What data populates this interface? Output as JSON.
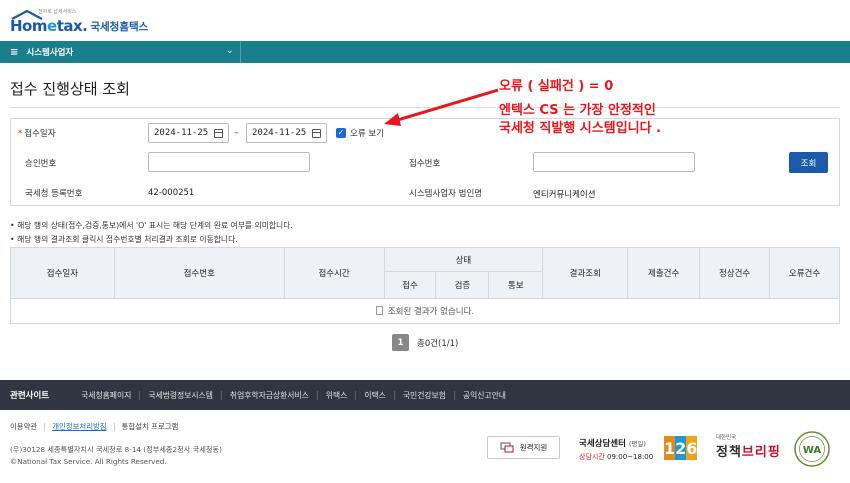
{
  "header": {
    "logo_tagline": "전자로 납세서비스",
    "logo_text_left": "Hom",
    "logo_text_e": "e",
    "logo_text_right": "tax.",
    "logo_kr": "국세청홈택스"
  },
  "nav": {
    "menu_label": "시스템사업자"
  },
  "page_title": "접수 진행상태 조회",
  "annotation": {
    "line1": "오류 ( 실패건 ) = 0",
    "line2": "엔텍스 CS 는 가장 안정적인",
    "line3": "국세청 직발행 시스템입니다 ."
  },
  "form": {
    "receipt_date_label": "접수일자",
    "date_from": "2024-11-25",
    "date_to": "2024-11-25",
    "date_sep": "–",
    "error_view_label": "오류 보기",
    "approval_no_label": "승인번호",
    "receipt_no_label": "접수번호",
    "search_button": "조회",
    "nts_reg_no_label": "국세청 등록번호",
    "nts_reg_no_value": "42-000251",
    "corp_name_label": "시스템사업자 법인명",
    "corp_name_value": "엔티커뮤니케이션"
  },
  "notes": {
    "note1": "• 해당 행의 상태(접수,검증,통보)에서 'O' 표시는 해당 단계의 완료 여부를 의미합니다.",
    "note2": "• 해당 행의 결과조회 클릭시 접수번호별 처리결과 조회로 이동합니다."
  },
  "table": {
    "headers": {
      "receipt_date": "접수일자",
      "receipt_no": "접수번호",
      "receipt_time": "접수시간",
      "status": "상태",
      "status_receipt": "접수",
      "status_verify": "검증",
      "status_notify": "통보",
      "result": "결과조회",
      "submitted": "제출건수",
      "normal": "정상건수",
      "error": "오류건수"
    },
    "empty_message": "조회된 결과가 없습니다."
  },
  "pager": {
    "current": "1",
    "total": "총0건(1/1)"
  },
  "footer": {
    "related_title": "관련사이트",
    "links": [
      "국세청홈페이지",
      "국세법령정보시스템",
      "취업후학자금상환서비스",
      "위택스",
      "이택스",
      "국민건강보험",
      "공익신고안내"
    ],
    "bottom_links": [
      "이용약관",
      "개인정보처리방침",
      "통합설치 프로그램"
    ],
    "address": "(우)30128 세종특별자치시 국세청로 8-14 (정부세종2청사 국세청동)",
    "copyright": "©National Tax Service. All Rights Reserved.",
    "remote_support": "원격지원",
    "center_title": "국세상담센터",
    "center_sub": "(평일)",
    "center_hours_label": "상담시간",
    "center_hours": "09:00~18:00",
    "center_number": [
      "1",
      "2",
      "6"
    ],
    "briefing_small": "대한민국",
    "briefing_big_1": "정책",
    "briefing_big_2": "브리핑",
    "wa_label": "WA"
  },
  "colors": {
    "nav": "#1b7e8c",
    "primary": "#1a5aa8",
    "annotation": "#e8171d",
    "footer_dark": "#2f3641",
    "num_1": "#e58a1f",
    "num_2": "#1c9ad6",
    "num_6": "#f0a21b"
  }
}
